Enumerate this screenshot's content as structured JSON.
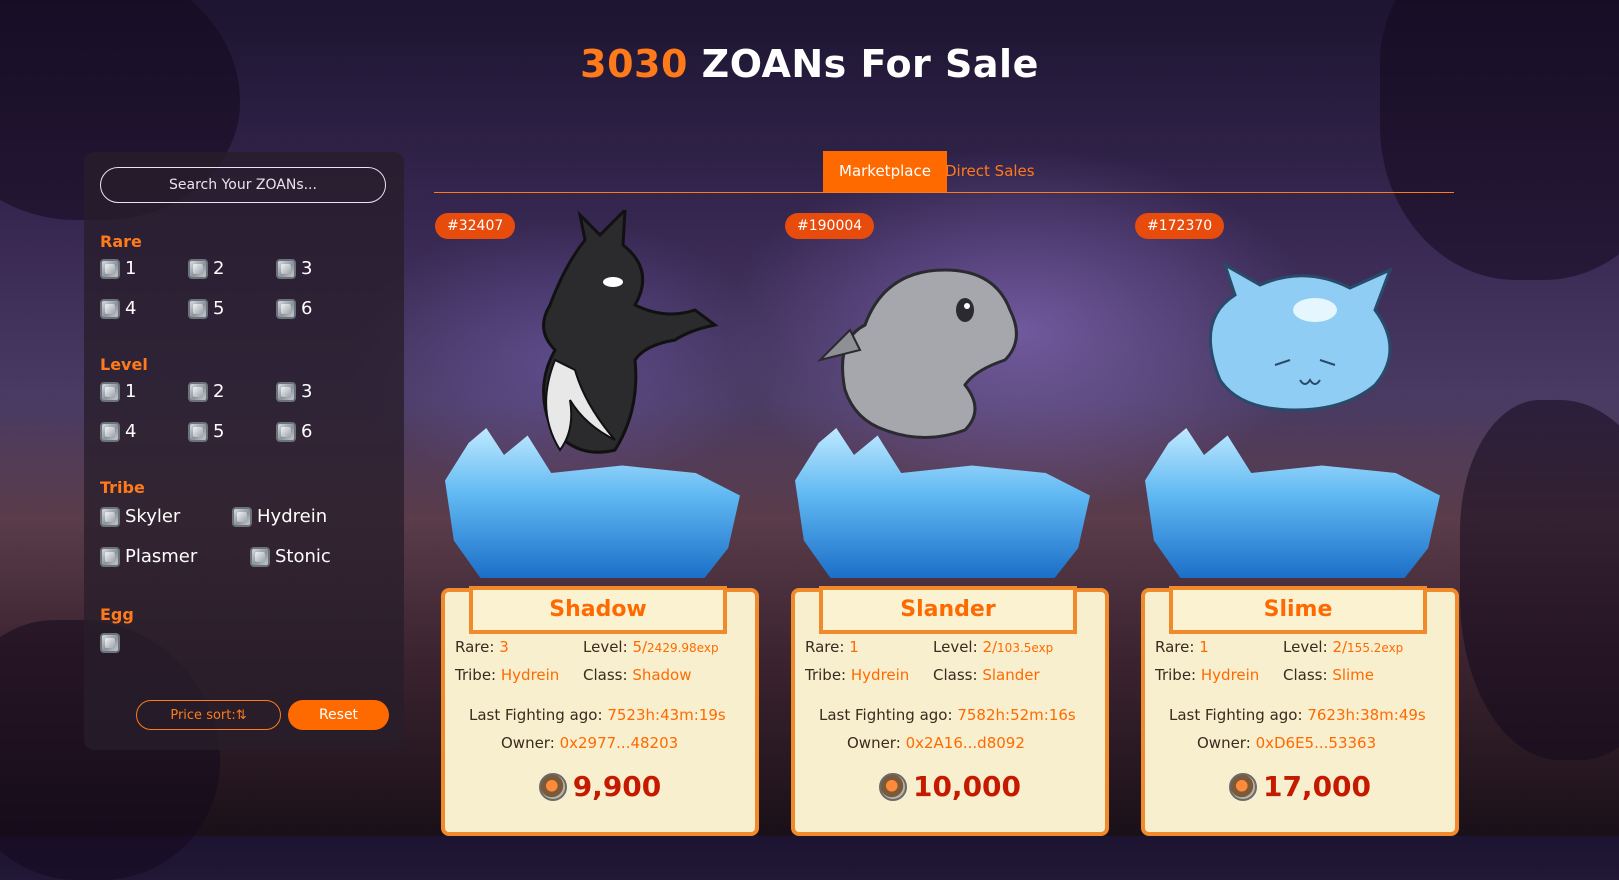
{
  "header": {
    "count": "3030",
    "title_rest": " ZOANs For Sale"
  },
  "search": {
    "placeholder": "Search Your ZOANs..."
  },
  "filters": {
    "rare": {
      "label": "Rare",
      "options": [
        "1",
        "2",
        "3",
        "4",
        "5",
        "6"
      ]
    },
    "level": {
      "label": "Level",
      "options": [
        "1",
        "2",
        "3",
        "4",
        "5",
        "6"
      ]
    },
    "tribe": {
      "label": "Tribe",
      "options": [
        "Skyler",
        "Hydrein",
        "Plasmer",
        "Stonic"
      ]
    },
    "egg": {
      "label": "Egg"
    },
    "price_sort_label": "Price sort:⇅",
    "reset_label": "Reset"
  },
  "tabs": {
    "marketplace": "Marketplace",
    "direct_sales": "Direct Sales"
  },
  "labels": {
    "rare": "Rare:",
    "level": "Level:",
    "tribe": "Tribe:",
    "class": "Class:",
    "last_fighting": "Last Fighting ago:",
    "owner": "Owner:"
  },
  "cards": [
    {
      "id": "#32407",
      "name": "Shadow",
      "rare": "3",
      "level": "5/",
      "exp": "2429.98exp",
      "tribe": "Hydrein",
      "class": "Shadow",
      "last_fighting": "7523h:43m:19s",
      "owner": "0x2977...48203",
      "price": "9,900",
      "creature": "shadow-creature"
    },
    {
      "id": "#190004",
      "name": "Slander",
      "rare": "1",
      "level": "2/",
      "exp": "103.5exp",
      "tribe": "Hydrein",
      "class": "Slander",
      "last_fighting": "7582h:52m:16s",
      "owner": "0x2A16...d8092",
      "price": "10,000",
      "creature": "slander-creature"
    },
    {
      "id": "#172370",
      "name": "Slime",
      "rare": "1",
      "level": "2/",
      "exp": "155.2exp",
      "tribe": "Hydrein",
      "class": "Slime",
      "last_fighting": "7623h:38m:49s",
      "owner": "0xD6E5...53363",
      "price": "17,000",
      "creature": "slime-creature"
    }
  ],
  "colors": {
    "accent": "#ff6a00",
    "price": "#c61a00"
  }
}
